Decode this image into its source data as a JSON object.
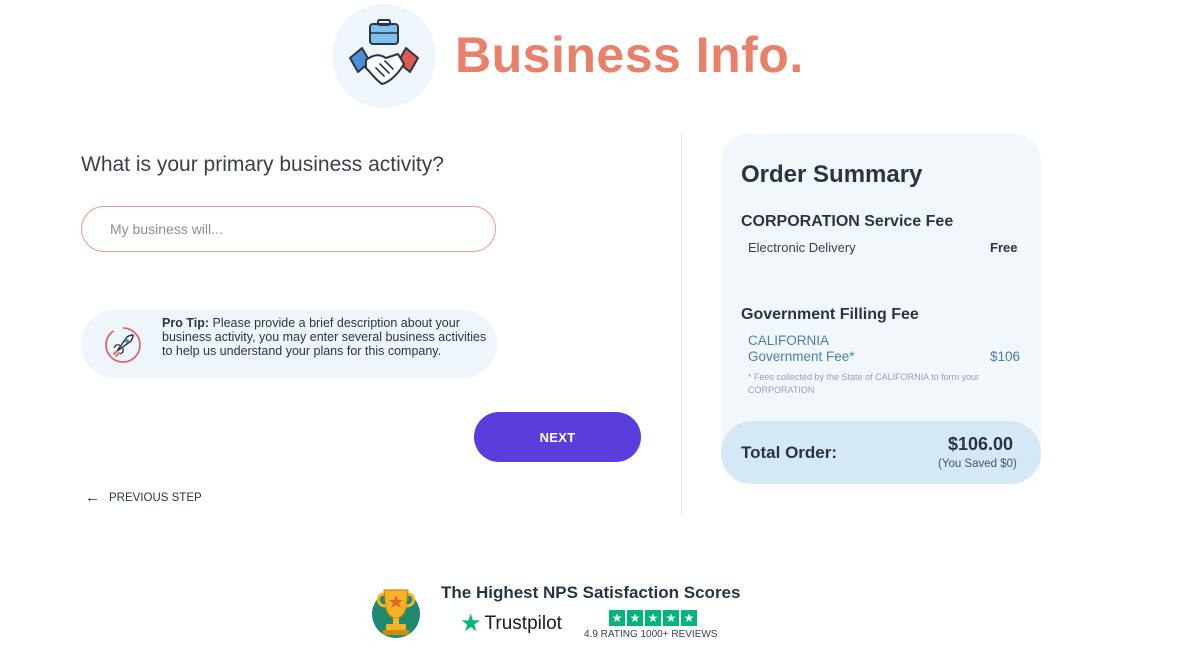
{
  "header": {
    "title": "Business Info.",
    "icon": "handshake-briefcase-icon"
  },
  "form": {
    "question": "What is your primary business activity?",
    "input_placeholder": "My business will...",
    "input_value": "",
    "tip": {
      "label": "Pro Tip:",
      "text": "Please provide a brief description about your business activity, you may enter several business activities to help us understand your plans for this company.",
      "icon": "rocket-icon"
    },
    "next_label": "NEXT",
    "previous_label": "PREVIOUS STEP"
  },
  "summary": {
    "title": "Order Summary",
    "service_title": "CORPORATION Service Fee",
    "delivery_label": "Electronic Delivery",
    "delivery_value": "Free",
    "gov_title": "Government Filling Fee",
    "state_line1": "CALIFORNIA",
    "state_line2": "Government Fee*",
    "state_price": "$106",
    "footnote": "* Fees collected by the State of CALIFORNIA to form your CORPORATION",
    "total_label": "Total Order:",
    "total_amount": "$106.00",
    "total_saved": "(You Saved $0)"
  },
  "trust": {
    "headline": "The Highest NPS Satisfaction Scores",
    "brand": "Trustpilot",
    "rating_stars": 5,
    "rating_text": "4.9 RATING  1000+ REVIEWS"
  },
  "colors": {
    "title": "#e8806a",
    "primary_button": "#5b3ddc",
    "input_border": "#e9a08f",
    "card_bg": "#f2f7fb",
    "total_bg": "#d5e8f5",
    "trustpilot_green": "#00b67a",
    "state_text": "#4a7bb5"
  }
}
